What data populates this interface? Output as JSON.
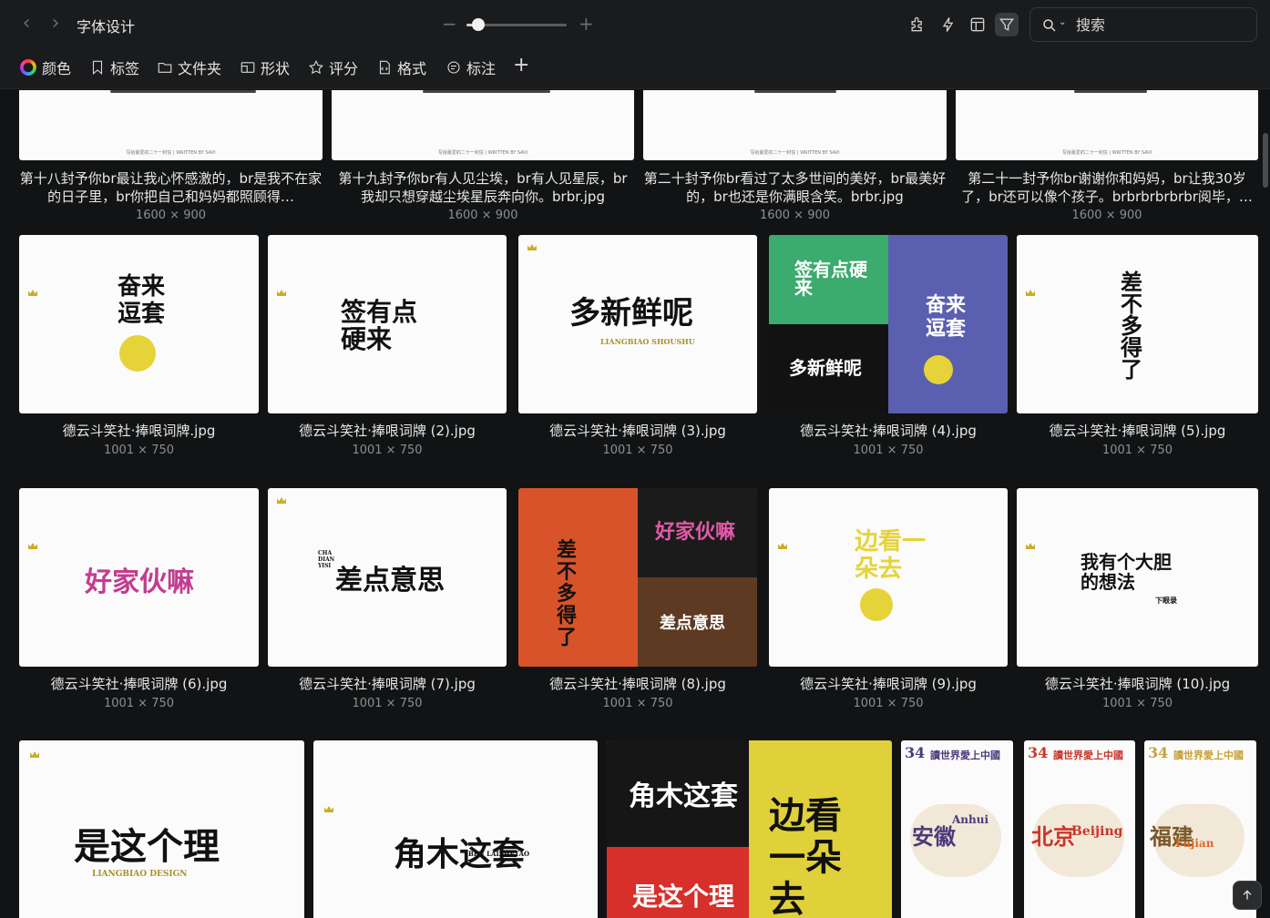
{
  "app": {
    "title": "字体设计",
    "search_placeholder": "搜索",
    "zoom_level": 0.12
  },
  "filters": {
    "color": "颜色",
    "tags": "标签",
    "folder": "文件夹",
    "shape": "形状",
    "rating": "评分",
    "format": "格式",
    "annotation": "标注"
  },
  "items": [
    {
      "name": "第十八封予你br最让我心怀感激的，br是我不在家的日子里，br你把自己和妈妈都照顾得…",
      "size": "1600 × 900"
    },
    {
      "name": "第十九封予你br有人见尘埃，br有人见星辰，br我却只想穿越尘埃星辰奔向你。brbr.jpg",
      "size": "1600 × 900"
    },
    {
      "name": "第二十封予你br看过了太多世间的美好，br最美好的，br也还是你满眼含笑。brbr.jpg",
      "size": "1600 × 900"
    },
    {
      "name": "第二十一封予你br谢谢你和妈妈，br让我30岁了，br还可以像个孩子。brbrbrbrbrbr阅毕，…",
      "size": "1600 × 900"
    },
    {
      "name": "德云斗笑社·捧哏词牌.jpg",
      "size": "1001 × 750"
    },
    {
      "name": "德云斗笑社·捧哏词牌 (2).jpg",
      "size": "1001 × 750"
    },
    {
      "name": "德云斗笑社·捧哏词牌 (3).jpg",
      "size": "1001 × 750"
    },
    {
      "name": "德云斗笑社·捧哏词牌 (4).jpg",
      "size": "1001 × 750"
    },
    {
      "name": "德云斗笑社·捧哏词牌 (5).jpg",
      "size": "1001 × 750"
    },
    {
      "name": "德云斗笑社·捧哏词牌 (6).jpg",
      "size": "1001 × 750"
    },
    {
      "name": "德云斗笑社·捧哏词牌 (7).jpg",
      "size": "1001 × 750"
    },
    {
      "name": "德云斗笑社·捧哏词牌 (8).jpg",
      "size": "1001 × 750"
    },
    {
      "name": "德云斗笑社·捧哏词牌 (9).jpg",
      "size": "1001 × 750"
    },
    {
      "name": "德云斗笑社·捧哏词牌 (10).jpg",
      "size": "1001 × 750"
    }
  ],
  "artwork": {
    "top_strip": "写给最爱的二十一封信 | WRITTEN BY SAVI",
    "t1": "奋来逗套",
    "t2": "签有点硬来",
    "t3": "多新鲜呢",
    "t3_sub": "LIANGBIAO SHOUSHU",
    "t5": "差不多得了",
    "t6": "好家伙嘛",
    "t7": "差点意思",
    "t7_pinyin": "CHA DIAN YISI",
    "t10": "我有个大胆的想法",
    "t10_sub": "下眼录",
    "b1": "是这个理",
    "b1_sub": "LIANGBIAO DESIGN",
    "b2": "角木这套",
    "b2_sub": "BEN LAIZHETAO",
    "b4": "边看一朵去",
    "p_num": "34",
    "p_head": "讀世界愛上中國",
    "p1": "安徽",
    "p1_en": "Anhui",
    "p2": "北京",
    "p2_en": "Beijing",
    "p3": "福建",
    "p3_en": "Fujian"
  }
}
